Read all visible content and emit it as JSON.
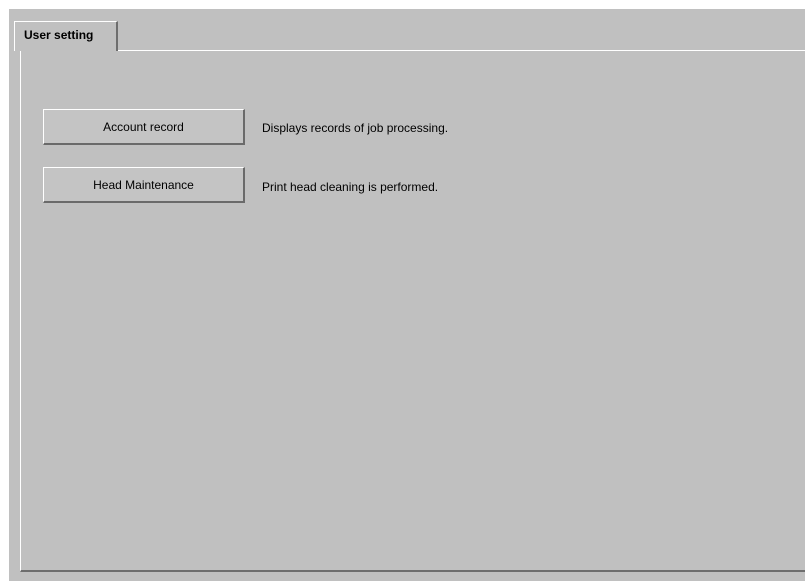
{
  "tab": {
    "label": "User setting"
  },
  "items": [
    {
      "button_label": "Account record",
      "description": "Displays records of job processing."
    },
    {
      "button_label": "Head Maintenance",
      "description": "Print head cleaning is performed."
    }
  ]
}
